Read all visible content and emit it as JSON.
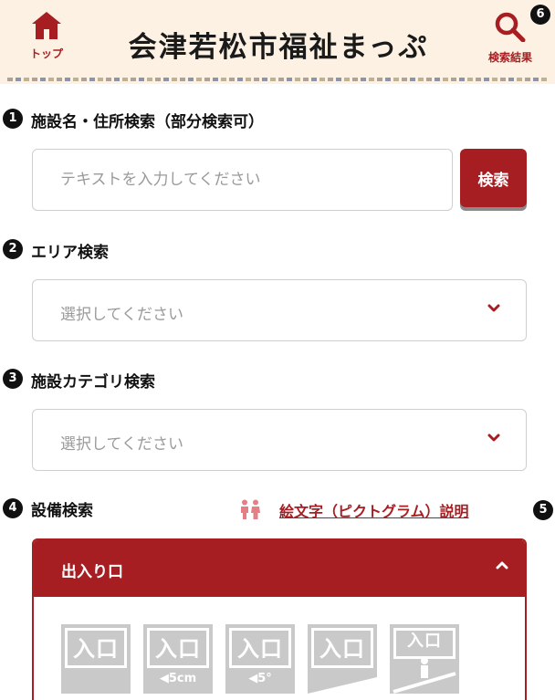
{
  "header": {
    "top_label": "トップ",
    "site_title": "会津若松市福祉まっぷ",
    "result_label": "検索結果",
    "result_marker": "6"
  },
  "section1": {
    "marker": "1",
    "title": "施設名・住所検索（部分検索可）",
    "placeholder": "テキストを入力してください",
    "button_label": "検索"
  },
  "section2": {
    "marker": "2",
    "title": "エリア検索",
    "selected": "選択してください"
  },
  "section3": {
    "marker": "3",
    "title": "施設カテゴリ検索",
    "selected": "選択してください"
  },
  "section4": {
    "marker": "4",
    "title": "設備検索",
    "pictogram_link": "絵文字（ピクトグラム）説明",
    "pictogram_marker": "5",
    "accordion_title": "出入り口",
    "icons": [
      {
        "label": "入口",
        "sub": ""
      },
      {
        "label": "入口",
        "sub": "◀5cm"
      },
      {
        "label": "入口",
        "sub": "◀5°"
      },
      {
        "label": "入口",
        "sub": ""
      },
      {
        "label": "入口",
        "sub": ""
      }
    ]
  },
  "colors": {
    "accent": "#a71e22",
    "header_bg": "#fcf1e3",
    "icon_gray": "#c9c9c9"
  }
}
